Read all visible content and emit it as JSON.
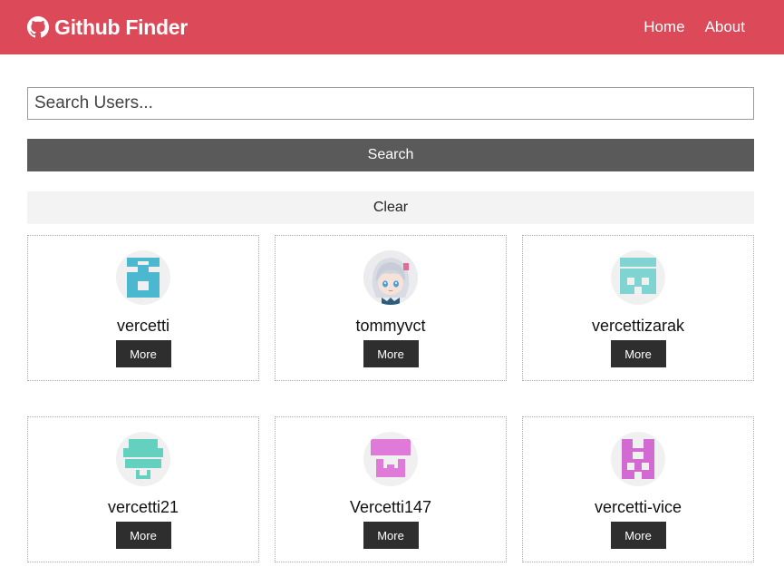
{
  "navbar": {
    "brand": "Github Finder",
    "links": [
      "Home",
      "About"
    ]
  },
  "search": {
    "placeholder": "Search Users...",
    "value": "",
    "search_label": "Search",
    "clear_label": "Clear"
  },
  "colors": {
    "navbar": "#dc4a59",
    "search_button": "#5a5a5a",
    "clear_button": "#f3f3f3",
    "more_button": "#2e2e2e"
  },
  "users": [
    {
      "login": "vercetti",
      "more_label": "More",
      "avatar": "identicon",
      "avatar_color": "#4bb8cf"
    },
    {
      "login": "tommyvct",
      "more_label": "More",
      "avatar": "anime-girl-avatar",
      "avatar_color": "#8ac6e8"
    },
    {
      "login": "vercettizarak",
      "more_label": "More",
      "avatar": "identicon",
      "avatar_color": "#7fd4d2"
    },
    {
      "login": "vercetti21",
      "more_label": "More",
      "avatar": "identicon",
      "avatar_color": "#64d0c0"
    },
    {
      "login": "Vercetti147",
      "more_label": "More",
      "avatar": "identicon",
      "avatar_color": "#e07ad8"
    },
    {
      "login": "vercetti-vice",
      "more_label": "More",
      "avatar": "identicon",
      "avatar_color": "#d26bd1"
    }
  ]
}
